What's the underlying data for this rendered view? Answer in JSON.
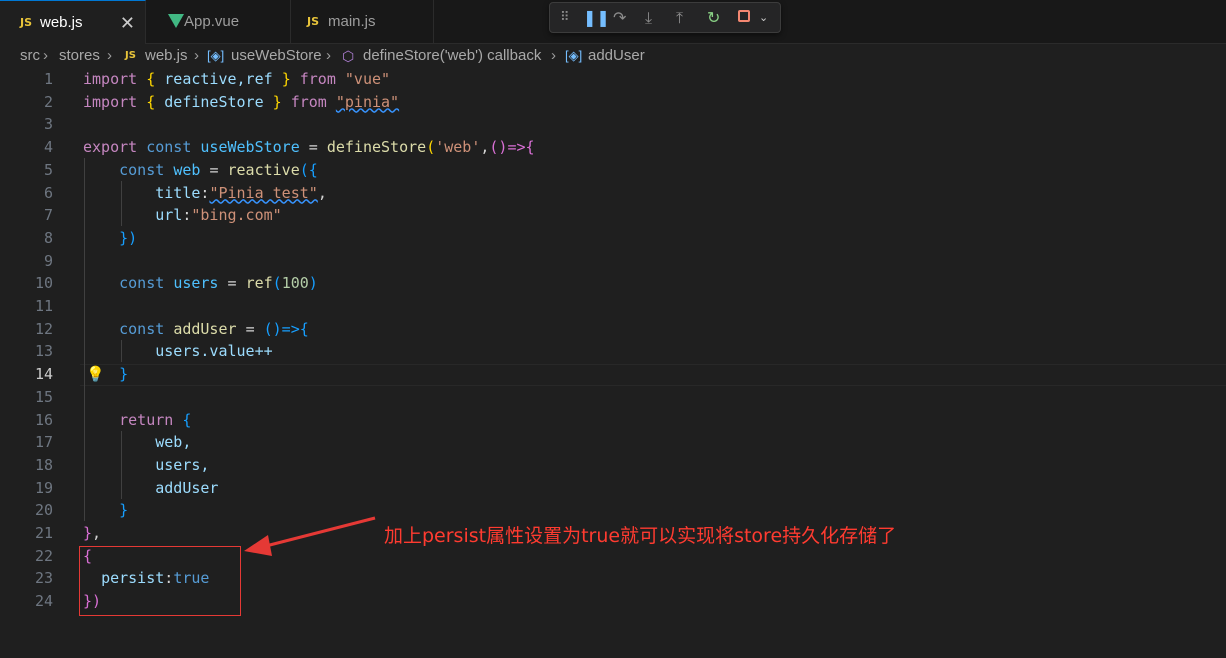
{
  "tabs": [
    {
      "icon": "js-file-icon",
      "badge": "JS",
      "label": "web.js",
      "active": true
    },
    {
      "icon": "vue-file-icon",
      "label": "App.vue",
      "active": false
    },
    {
      "icon": "js-file-icon",
      "badge": "JS",
      "label": "main.js",
      "active": false
    }
  ],
  "breadcrumb": {
    "src": "src",
    "stores": "stores",
    "file_badge": "JS",
    "file": "web.js",
    "symbol1": "useWebStore",
    "symbol2": "defineStore('web') callback",
    "symbol3": "addUser"
  },
  "debug_toolbar": [
    "drag-handle-icon",
    "pause-icon",
    "step-over-icon",
    "step-into-icon",
    "step-out-icon",
    "restart-icon",
    "stop-icon"
  ],
  "current_line": 14,
  "line_numbers": [
    "1",
    "2",
    "3",
    "4",
    "5",
    "6",
    "7",
    "8",
    "9",
    "10",
    "11",
    "12",
    "13",
    "14",
    "15",
    "16",
    "17",
    "18",
    "19",
    "20",
    "21",
    "22",
    "23",
    "24"
  ],
  "code": {
    "l1": {
      "import": "import",
      "brace_open": "{",
      "names": "reactive,ref",
      "brace_close": "}",
      "from": "from",
      "module": "\"vue\""
    },
    "l2": {
      "import": "import",
      "brace_open": "{",
      "names": "defineStore",
      "brace_close": "}",
      "from": "from",
      "module": "\"pinia\""
    },
    "l4": {
      "export": "export",
      "const": "const",
      "name": "useWebStore",
      "eq": "=",
      "fn": "defineStore",
      "paren": "(",
      "arg": "'web'",
      "comma": ",",
      "arrow": "()=>{"
    },
    "l5": {
      "const": "const",
      "name": "web",
      "eq": "=",
      "fn": "reactive",
      "open": "({"
    },
    "l6": {
      "key": "title",
      "colon": ":",
      "value": "\"Pinia test\"",
      "comma": ","
    },
    "l7": {
      "key": "url",
      "colon": ":",
      "value": "\"bing.com\""
    },
    "l8": {
      "close": "})"
    },
    "l10": {
      "const": "const",
      "name": "users",
      "eq": "=",
      "fn": "ref",
      "open": "(",
      "num": "100",
      "close": ")"
    },
    "l12": {
      "const": "const",
      "name": "addUser",
      "eq": "=",
      "arrow": "()=>{"
    },
    "l13": {
      "text": "users.value++"
    },
    "l14": {
      "close": "}"
    },
    "l16": {
      "return": "return",
      "open": "{"
    },
    "l17": {
      "text": "web,"
    },
    "l18": {
      "text": "users,"
    },
    "l19": {
      "text": "addUser"
    },
    "l20": {
      "close": "}"
    },
    "l21": {
      "close": "}",
      "comma": ","
    },
    "l22": {
      "open": "{"
    },
    "l23": {
      "key": "persist",
      "colon": ":",
      "value": "true"
    },
    "l24": {
      "close": "})"
    }
  },
  "annotation": {
    "text": "加上persist属性设置为true就可以实现将store持久化存储了",
    "color": "#ff3b30"
  },
  "colors": {
    "editor_bg": "#1f1f1f",
    "keyword": "#569cd6",
    "control_keyword": "#c586c0",
    "function": "#dcdcaa",
    "variable": "#9cdcfe",
    "string": "#ce9178",
    "number": "#b5cea8",
    "accent": "#0078d4"
  }
}
